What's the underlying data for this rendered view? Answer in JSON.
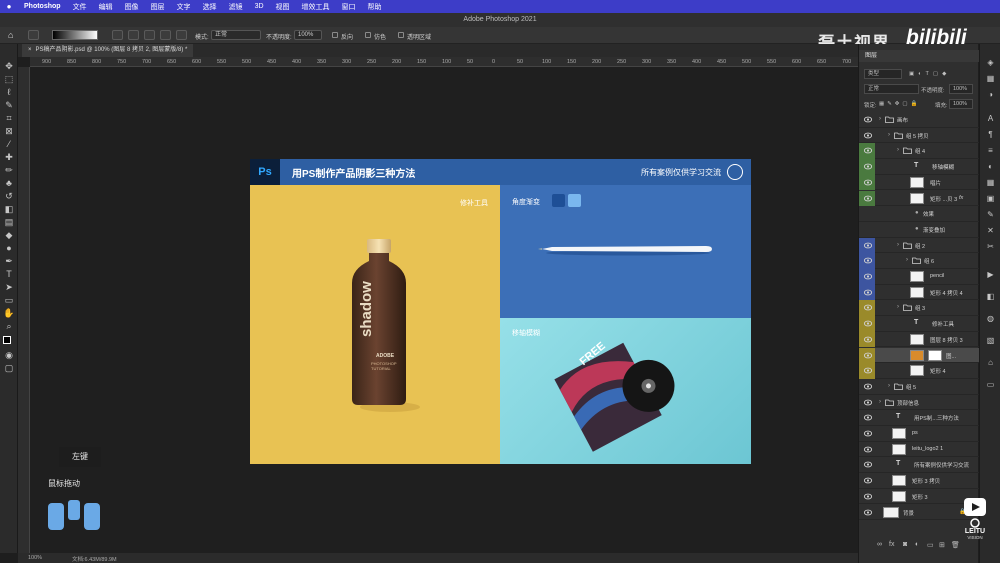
{
  "menubar": {
    "app_name": "Photoshop",
    "items": [
      "文件",
      "编辑",
      "图像",
      "图层",
      "文字",
      "选择",
      "滤镜",
      "3D",
      "视图",
      "增效工具",
      "窗口",
      "帮助"
    ]
  },
  "titlebar": {
    "title": "Adobe Photoshop 2021"
  },
  "options": {
    "mode_label": "模式:",
    "mode_value": "正常",
    "opacity_label": "不透明度:",
    "opacity_value": "100%",
    "reverse_label": "反向",
    "dither_label": "仿色",
    "transparency_label": "透明区域"
  },
  "watermark": {
    "site": "磊土视界",
    "logo": "bilibili"
  },
  "document": {
    "tab_title": "PS稿产品阴影.psd @ 100% (图层 8 拷贝 2, 图层蒙版/8) *"
  },
  "ruler": {
    "ticks": [
      "900",
      "850",
      "800",
      "750",
      "700",
      "650",
      "600",
      "550",
      "500",
      "450",
      "400",
      "350",
      "300",
      "250",
      "200",
      "150",
      "100",
      "50",
      "0",
      "50",
      "100",
      "150",
      "200",
      "250",
      "300",
      "350",
      "400",
      "450",
      "500",
      "550",
      "600",
      "650",
      "700",
      "750"
    ]
  },
  "artwork": {
    "ps_badge": "Ps",
    "title": "用PS制作产品阴影三种方法",
    "note": "所有案例仅供学习交流",
    "label_yellow": "修补工具",
    "label_blue": "角度渐变",
    "label_cyan": "移轴模糊",
    "bottle_word": "shadow",
    "bottle_brand": "ADOBE",
    "bottle_sub": "PHOTOSHOP\nTUTORIAL",
    "card_word": "FREE",
    "colors": {
      "banner": "#2e5fa3",
      "yellow": "#e8c253",
      "blue": "#3c6fb7",
      "cyan": "#7fd3dd",
      "swatch_dark": "#1e4f96",
      "swatch_light": "#7ab7ee"
    }
  },
  "hints": {
    "left_key": "左键",
    "mouse_drag": "鼠标拖动"
  },
  "status": {
    "zoom": "100%",
    "doc_info": "文档:6.43M/89.9M"
  },
  "layers_panel": {
    "title": "图层",
    "filter_label": "类型",
    "blend_mode": "正常",
    "opacity_label": "不透明度:",
    "opacity_value": "100%",
    "lock_label": "锁定:",
    "fill_label": "填充:",
    "fill_value": "100%",
    "layers": [
      {
        "name": "画布",
        "kind": "group",
        "indent": 0,
        "band": ""
      },
      {
        "name": "组 5 拷贝",
        "kind": "group",
        "indent": 1,
        "band": ""
      },
      {
        "name": "组 4",
        "kind": "group",
        "indent": 2,
        "band": "#4a7a3f"
      },
      {
        "name": "移轴模糊",
        "kind": "text",
        "indent": 3,
        "band": "#4a7a3f"
      },
      {
        "name": "唱片",
        "kind": "smart",
        "indent": 3,
        "band": "#4a7a3f"
      },
      {
        "name": "矩形 ...贝 3",
        "kind": "smart",
        "indent": 3,
        "band": "#4a7a3f",
        "fx": "fx"
      },
      {
        "name": "效果",
        "kind": "effect",
        "indent": 4,
        "band": ""
      },
      {
        "name": "渐变叠加",
        "kind": "effect",
        "indent": 4,
        "band": ""
      },
      {
        "name": "组 2",
        "kind": "group",
        "indent": 2,
        "band": "#3d55a0"
      },
      {
        "name": "组 6",
        "kind": "group",
        "indent": 3,
        "band": "#3d55a0"
      },
      {
        "name": "pencil",
        "kind": "smart",
        "indent": 3,
        "band": "#3d55a0"
      },
      {
        "name": "矩形 4 拷贝 4",
        "kind": "smart",
        "indent": 3,
        "band": "#3d55a0"
      },
      {
        "name": "组 3",
        "kind": "group",
        "indent": 2,
        "band": "#9a8a2a"
      },
      {
        "name": "修补工具",
        "kind": "text",
        "indent": 3,
        "band": "#9a8a2a"
      },
      {
        "name": "图层 8 拷贝 3",
        "kind": "smart",
        "indent": 3,
        "band": "#9a8a2a"
      },
      {
        "name": "图...",
        "kind": "mask",
        "indent": 3,
        "band": "#9a8a2a",
        "selected": true
      },
      {
        "name": "矩形 4",
        "kind": "smart",
        "indent": 3,
        "band": "#9a8a2a"
      },
      {
        "name": "组 5",
        "kind": "group",
        "indent": 1,
        "band": ""
      },
      {
        "name": "顶部信息",
        "kind": "group",
        "indent": 0,
        "band": ""
      },
      {
        "name": "用PS制...三种方法",
        "kind": "text",
        "indent": 1,
        "band": ""
      },
      {
        "name": "ps",
        "kind": "pixel",
        "indent": 1,
        "band": ""
      },
      {
        "name": "leitu_logo2 1",
        "kind": "smart",
        "indent": 1,
        "band": ""
      },
      {
        "name": "所有案例仅供学习交流",
        "kind": "text",
        "indent": 1,
        "band": ""
      },
      {
        "name": "矩形 3 拷贝",
        "kind": "smart",
        "indent": 1,
        "band": ""
      },
      {
        "name": "矩形 3",
        "kind": "smart",
        "indent": 1,
        "band": ""
      },
      {
        "name": "背景",
        "kind": "background",
        "indent": 0,
        "band": ""
      }
    ]
  },
  "leitu": {
    "name": "LEITU",
    "sub": "VISION"
  }
}
